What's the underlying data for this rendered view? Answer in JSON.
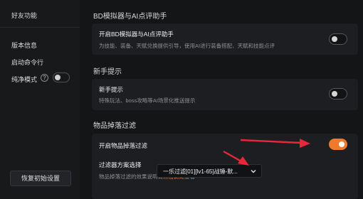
{
  "sidebar": {
    "items": [
      {
        "label": "好友功能"
      },
      {
        "label": "版本信息"
      },
      {
        "label": "启动命令行"
      },
      {
        "label": "纯净模式"
      }
    ],
    "pure_mode_help": "?",
    "pure_mode_on": false,
    "reset_button": "恢复初始设置"
  },
  "sections": {
    "bd": {
      "title": "BD模拟器与AI点评助手",
      "card_title": "开启BD模拟器与AI点评助手",
      "card_desc": "为技能、装备、天赋兑换提供引导，使用AI进行装备搭配、天赋和技能点评",
      "enabled": false
    },
    "newbie": {
      "title": "新手提示",
      "card_title": "新手提示",
      "card_desc": "特殊玩法、boss攻略等AI场景化推送提示",
      "enabled": false
    },
    "filter": {
      "title": "物品掉落过滤",
      "toggle_label": "开启物品掉落过滤",
      "enabled": true,
      "scheme_label": "过滤器方案选择",
      "scheme_desc_prefix": "物品掉落过滤的效果说明请",
      "scheme_desc_link": "点击此处",
      "scheme_desc_suffix": "查看",
      "selected_scheme": "一乐过滤[01][lv1-65]战锤-默..."
    }
  },
  "colors": {
    "accent": "#f07a2a",
    "arrow": "#e8283a"
  }
}
